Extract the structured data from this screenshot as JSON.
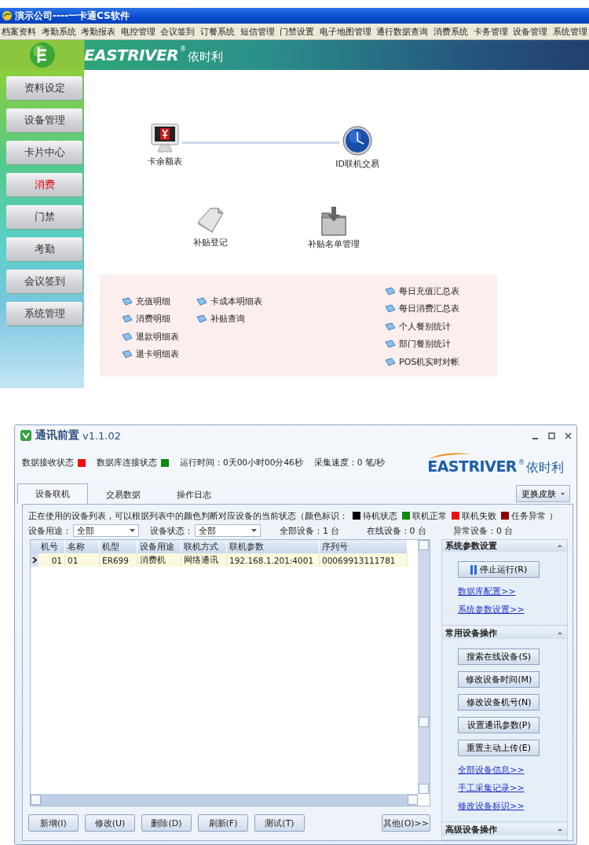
{
  "top_window": {
    "title": "演示公司----一卡通CS软件",
    "menu": [
      "档案资料",
      "考勤系统",
      "考勤报表",
      "电控管理",
      "会议签到",
      "订餐系统",
      "短信管理",
      "门禁设置",
      "电子地图管理",
      "通行数据查询",
      "消费系统",
      "卡务管理",
      "设备管理",
      "系统管理"
    ],
    "brand": {
      "name": "EASTRIVER",
      "mark": "®",
      "cn": "依时利"
    },
    "sidebar": {
      "items": [
        {
          "label": "资料设定",
          "selected": false
        },
        {
          "label": "设备管理",
          "selected": false
        },
        {
          "label": "卡片中心",
          "selected": false
        },
        {
          "label": "消费",
          "selected": true
        },
        {
          "label": "门禁",
          "selected": false
        },
        {
          "label": "考勤",
          "selected": false
        },
        {
          "label": "会议签到",
          "selected": false
        },
        {
          "label": "系统管理",
          "selected": false
        }
      ]
    },
    "shortcuts": [
      {
        "label": "卡余额表",
        "kind": "monitor"
      },
      {
        "label": "ID联机交易",
        "kind": "clock"
      },
      {
        "label": "补贴登记",
        "kind": "document"
      },
      {
        "label": "补贴名单管理",
        "kind": "folder"
      }
    ],
    "report_links": {
      "columns": [
        {
          "links": [
            "充值明细",
            "消费明细",
            "退款明细表",
            "退卡明细表"
          ]
        },
        {
          "links": [
            "卡成本明细表",
            "补贴查询"
          ]
        },
        {
          "links": [
            "每日充值汇总表",
            "每日消费汇总表",
            "个人餐别统计",
            "部门餐别统计",
            "POS机实时对帐"
          ]
        }
      ]
    }
  },
  "comm_window": {
    "title": "通讯前置",
    "version": "v1.1.02",
    "status": [
      {
        "label": "数据接收状态",
        "color": "#ee1111"
      },
      {
        "label": "数据库连接状态",
        "color": "#118811"
      }
    ],
    "runtime": "运行时间：0天00小时00分46秒",
    "speed": "采集速度：0 笔/秒",
    "brand": {
      "name": "EASTRIVER",
      "mark": "®",
      "cn": "依时利"
    },
    "tabs": [
      {
        "label": "设备联机",
        "selected": true
      },
      {
        "label": "交易数据",
        "selected": false
      },
      {
        "label": "操作日志",
        "selected": false
      }
    ],
    "skin_button": "更换皮肤",
    "legend": {
      "text": "正在使用的设备列表，可以根据列表中的颜色判断对应设备的当前状态（颜色标识：",
      "items": [
        {
          "label": "待机状态",
          "color": "#000000"
        },
        {
          "label": "联机正常",
          "color": "#118811"
        },
        {
          "label": "联机失败",
          "color": "#ee1111"
        },
        {
          "label": "任务异常",
          "color": "#8b0000"
        }
      ],
      "close": "）"
    },
    "filters": [
      {
        "label": "设备用途：",
        "value": "全部"
      },
      {
        "label": "设备状态：",
        "value": "全部"
      }
    ],
    "counts": [
      "全部设备：1 台",
      "在线设备：0 台",
      "异常设备：0 台"
    ],
    "table": {
      "columns": [
        "机号",
        "名称",
        "机型",
        "设备用途",
        "联机方式",
        "联机参数",
        "序列号"
      ],
      "rows": [
        {
          "cells": [
            "01",
            "01",
            "ER699",
            "消费机",
            "网络通讯",
            "192.168.1.201:4001",
            "00069913111781"
          ],
          "selected": true
        }
      ]
    },
    "side_panel": [
      {
        "title": "系统参数设置",
        "buttons": [
          {
            "label": "停止运行(R)",
            "kind": "stop"
          }
        ],
        "links": [
          "数据库配置>>",
          "系统参数设置>>"
        ]
      },
      {
        "title": "常用设备操作",
        "buttons": [
          {
            "label": "搜索在线设备(S)",
            "kind": "command"
          },
          {
            "label": "修改设备时间(M)",
            "kind": "command"
          },
          {
            "label": "修改设备机号(N)",
            "kind": "command"
          },
          {
            "label": "设置通讯参数(P)",
            "kind": "command"
          },
          {
            "label": "重置主动上传(E)",
            "kind": "command"
          }
        ],
        "links": [
          "全部设备信息>>",
          "手工采集记录>>",
          "修改设备标识>>"
        ]
      },
      {
        "title": "高级设备操作"
      }
    ],
    "actions": [
      "新增(I)",
      "修改(U)",
      "删除(D)",
      "刷新(F)",
      "测试(T)"
    ],
    "more_button": "其他(O)>>"
  }
}
